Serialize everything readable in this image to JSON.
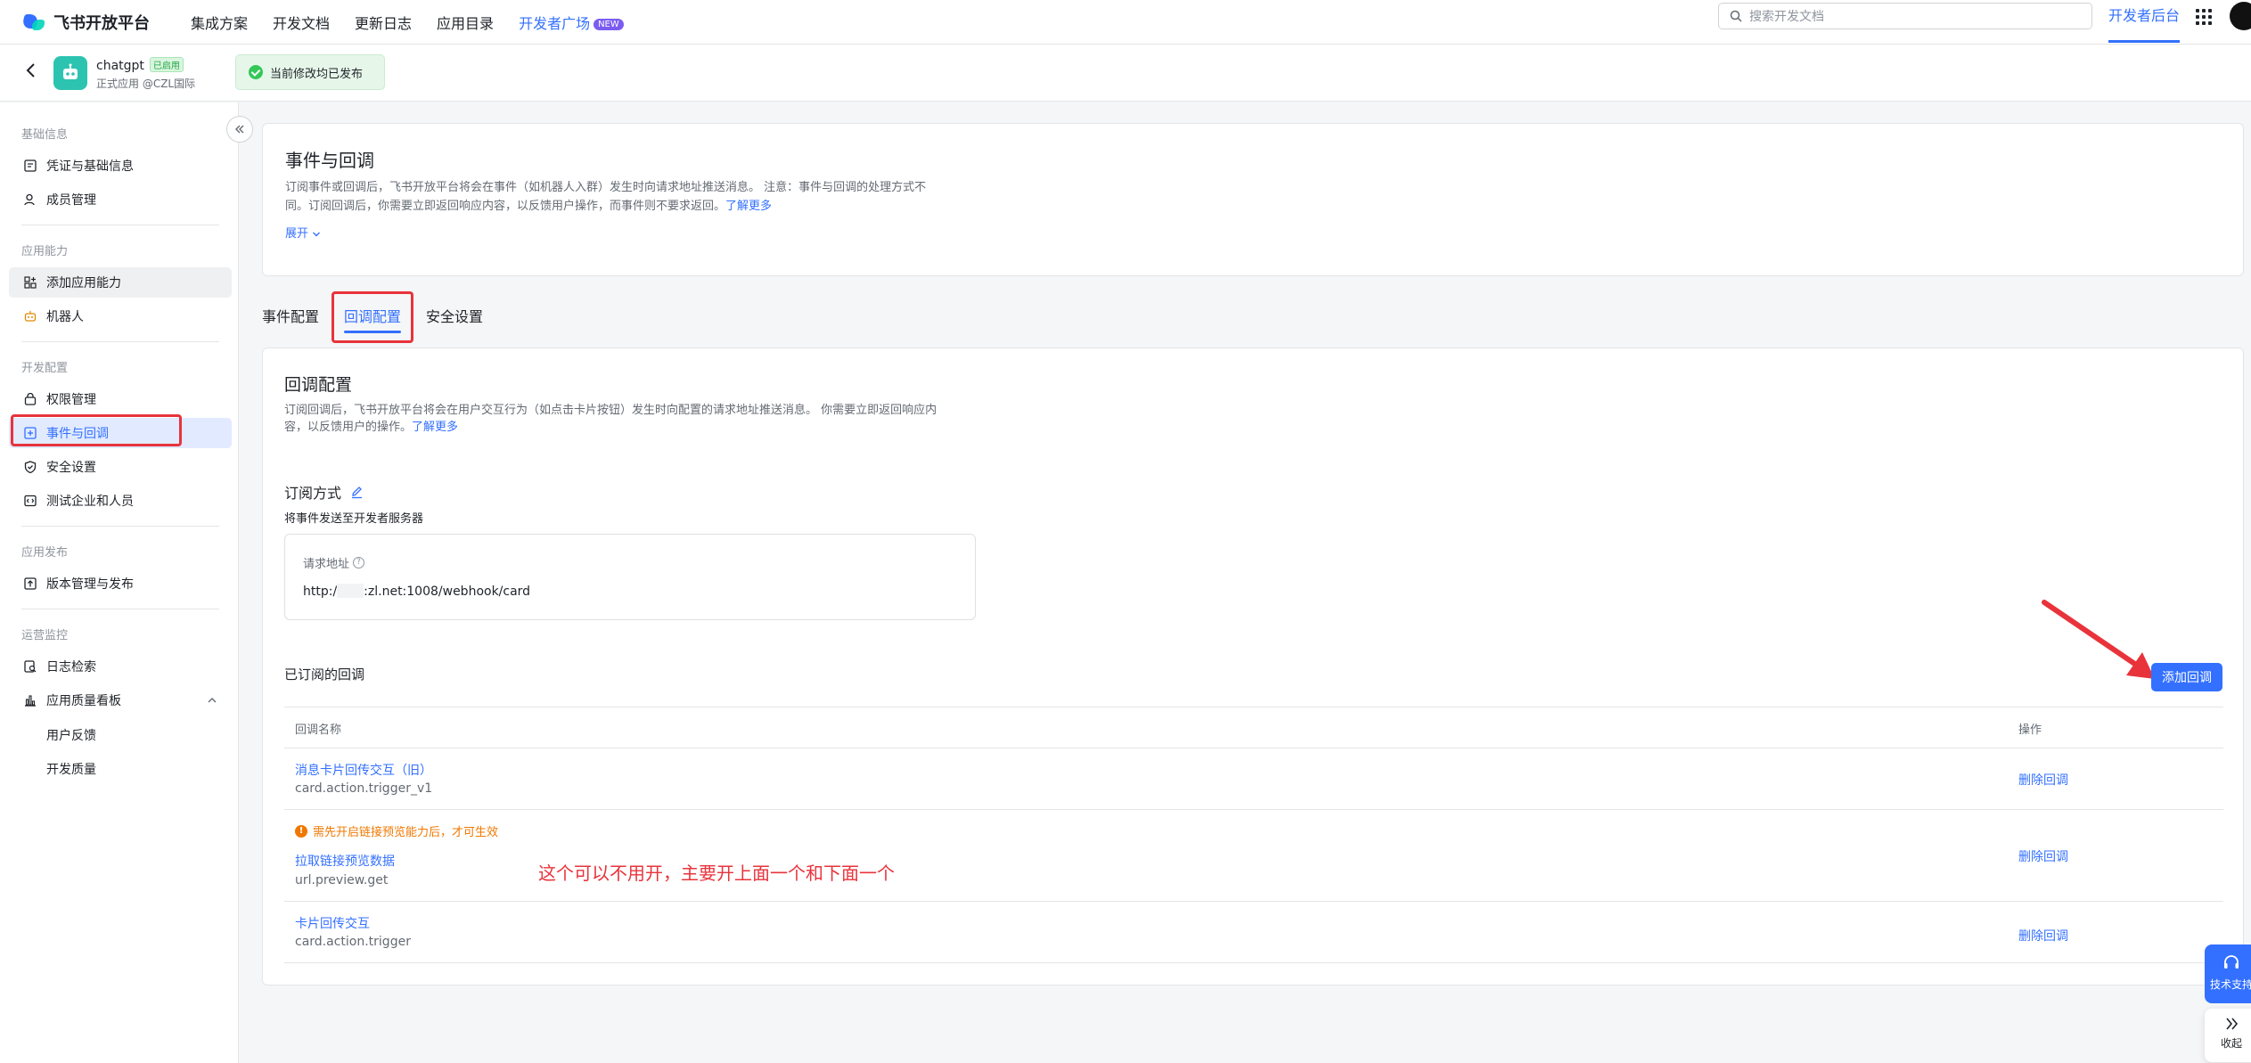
{
  "topbar": {
    "brand": "飞书开放平台",
    "nav": [
      "集成方案",
      "开发文档",
      "更新日志",
      "应用目录"
    ],
    "developer_square": "开发者广场",
    "new_badge": "NEW",
    "search_placeholder": "搜索开发文档",
    "dev_console": "开发者后台"
  },
  "app": {
    "name": "chatgpt",
    "status": "已启用",
    "subtitle": "正式应用 @CZL国际",
    "publish_tip": "当前修改均已发布"
  },
  "sidebar": {
    "sections": [
      {
        "title": "基础信息",
        "items": [
          "凭证与基础信息",
          "成员管理"
        ]
      },
      {
        "title": "应用能力",
        "items": [
          "添加应用能力",
          "机器人"
        ]
      },
      {
        "title": "开发配置",
        "items": [
          "权限管理",
          "事件与回调",
          "安全设置",
          "测试企业和人员"
        ]
      },
      {
        "title": "应用发布",
        "items": [
          "版本管理与发布"
        ]
      },
      {
        "title": "运营监控",
        "items": [
          "日志检索",
          "应用质量看板"
        ],
        "subitems": [
          "用户反馈",
          "开发质量"
        ]
      }
    ],
    "active_item": "事件与回调"
  },
  "intro": {
    "title": "事件与回调",
    "desc_line1": "订阅事件或回调后，飞书开放平台将会在事件（如机器人入群）发生时向请求地址推送消息。 注意：事件与回调的处理方式不",
    "desc_line2": "同。订阅回调后，你需要立即返回响应内容，以反馈用户操作，而事件则不要求返回。",
    "learn_more": "了解更多",
    "expand": "展开"
  },
  "tabs": [
    "事件配置",
    "回调配置",
    "安全设置"
  ],
  "active_tab": "回调配置",
  "callback": {
    "title": "回调配置",
    "desc_line1": "订阅回调后，飞书开放平台将会在用户交互行为（如点击卡片按钮）发生时向配置的请求地址推送消息。 你需要立即返回响应内",
    "desc_line2": "容，以反馈用户的操作。",
    "learn_more": "了解更多",
    "subscribe_mode_label": "订阅方式",
    "subscribe_mode_value": "将事件发送至开发者服务器",
    "request_url_label": "请求地址",
    "request_url_prefix": "http:/",
    "request_url_suffix": ":zl.net:1008/webhook/card",
    "subscribed_title": "已订阅的回调",
    "add_button": "添加回调",
    "table_headers": [
      "回调名称",
      "操作"
    ],
    "rows": [
      {
        "name": "消息卡片回传交互（旧）",
        "code": "card.action.trigger_v1",
        "op": "删除回调",
        "warning": ""
      },
      {
        "name": "拉取链接预览数据",
        "code": "url.preview.get",
        "op": "删除回调",
        "warning": "需先开启链接预览能力后，才可生效"
      },
      {
        "name": "卡片回传交互",
        "code": "card.action.trigger",
        "op": "删除回调",
        "warning": ""
      }
    ],
    "annotation": "这个可以不用开，主要开上面一个和下面一个"
  },
  "float": {
    "support": "技术支持",
    "collapse": "收起"
  },
  "colors": {
    "accent": "#3370ff",
    "annotation_red": "#e8333b",
    "warning": "#f07800"
  }
}
